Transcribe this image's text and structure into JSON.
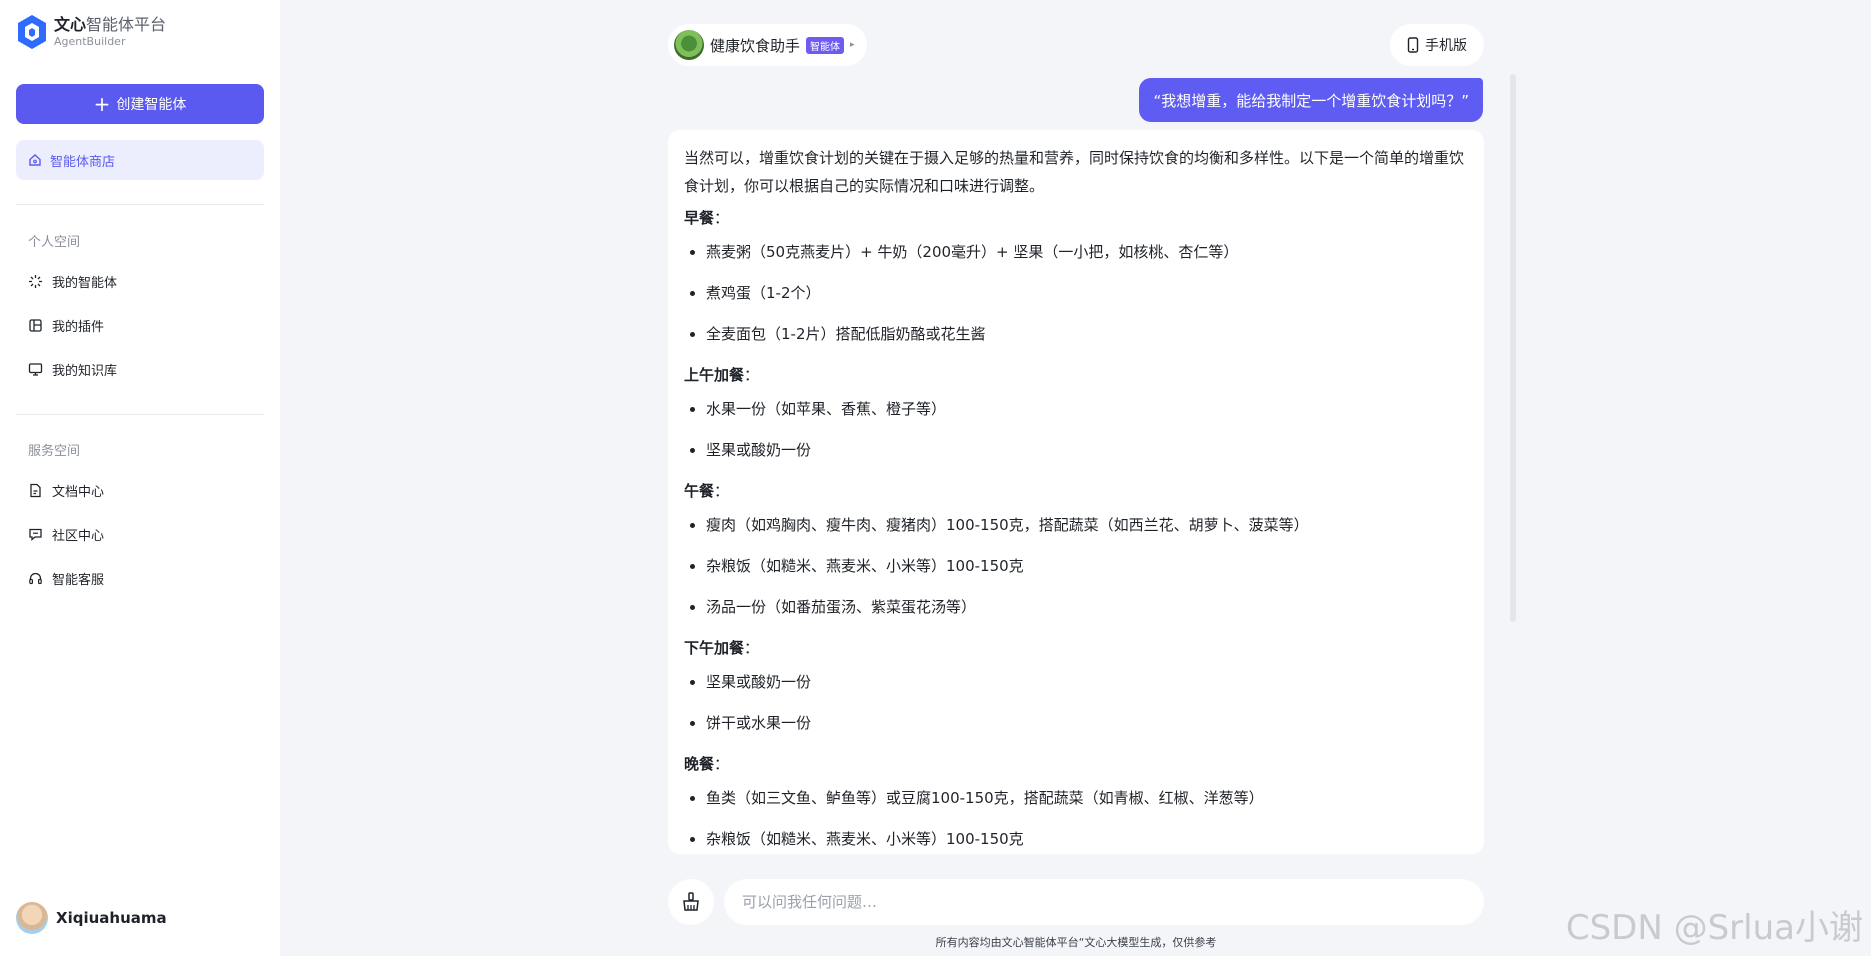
{
  "brand": {
    "title_bold": "文心",
    "title_rest": "智能体平台",
    "subtitle": "AgentBuilder"
  },
  "sidebar": {
    "create_label": "创建智能体",
    "store_label": "智能体商店",
    "personal_section": "个人空间",
    "personal_items": [
      {
        "label": "我的智能体",
        "icon": "sparkle-icon"
      },
      {
        "label": "我的插件",
        "icon": "plugin-icon"
      },
      {
        "label": "我的知识库",
        "icon": "monitor-icon"
      }
    ],
    "service_section": "服务空间",
    "service_items": [
      {
        "label": "文档中心",
        "icon": "document-icon"
      },
      {
        "label": "社区中心",
        "icon": "chat-icon"
      },
      {
        "label": "智能客服",
        "icon": "headset-icon"
      }
    ],
    "user_name": "Xiqiuahuama"
  },
  "chat": {
    "agent_name": "健康饮食助手",
    "agent_badge": "智能体",
    "mobile_label": "手机版",
    "user_message": "“我想增重，能给我制定一个增重饮食计划吗？”",
    "answer": {
      "intro": "当然可以，增重饮食计划的关键在于摄入足够的热量和营养，同时保持饮食的均衡和多样性。以下是一个简单的增重饮食计划，你可以根据自己的实际情况和口味进行调整。",
      "sections": [
        {
          "title": "早餐",
          "items": [
            "燕麦粥（50克燕麦片）+ 牛奶（200毫升）+ 坚果（一小把，如核桃、杏仁等）",
            "煮鸡蛋（1-2个）",
            "全麦面包（1-2片）搭配低脂奶酪或花生酱"
          ]
        },
        {
          "title": "上午加餐",
          "items": [
            "水果一份（如苹果、香蕉、橙子等）",
            "坚果或酸奶一份"
          ]
        },
        {
          "title": "午餐",
          "items": [
            "瘦肉（如鸡胸肉、瘦牛肉、瘦猪肉）100-150克，搭配蔬菜（如西兰花、胡萝卜、菠菜等）",
            "杂粮饭（如糙米、燕麦米、小米等）100-150克",
            "汤品一份（如番茄蛋汤、紫菜蛋花汤等）"
          ]
        },
        {
          "title": "下午加餐",
          "items": [
            "坚果或酸奶一份",
            "饼干或水果一份"
          ]
        },
        {
          "title": "晚餐",
          "items": [
            "鱼类（如三文鱼、鲈鱼等）或豆腐100-150克，搭配蔬菜（如青椒、红椒、洋葱等）",
            "杂粮饭（如糙米、燕麦米、小米等）100-150克"
          ]
        }
      ]
    },
    "input_placeholder": "可以问我任何问题…",
    "footer_note": "所有内容均由文心智能体平台“文心大模型生成，仅供参考"
  },
  "watermark": "CSDN @Srlua小谢",
  "colors": {
    "accent": "#5a5af0",
    "store_bg": "#eceefd",
    "page_bg": "#f4f5f9"
  }
}
